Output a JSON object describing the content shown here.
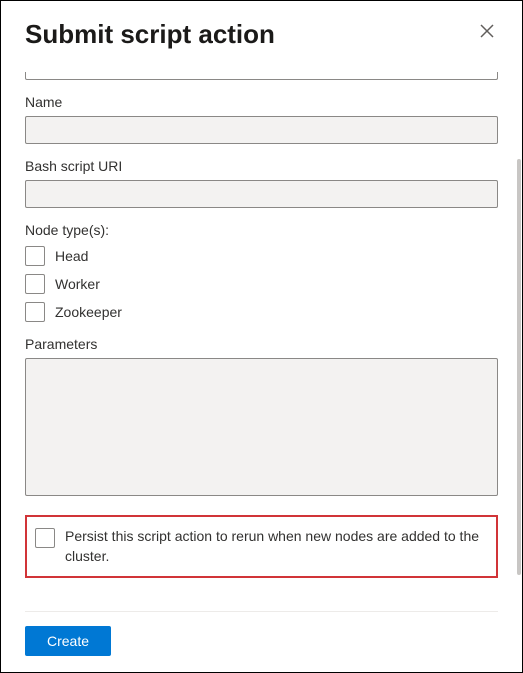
{
  "header": {
    "title": "Submit script action"
  },
  "fields": {
    "name_label": "Name",
    "name_value": "",
    "uri_label": "Bash script URI",
    "uri_value": "",
    "node_types_label": "Node type(s):",
    "node_types": {
      "head": "Head",
      "worker": "Worker",
      "zookeeper": "Zookeeper"
    },
    "parameters_label": "Parameters",
    "parameters_value": "",
    "persist_label": "Persist this script action to rerun when new nodes are added to the cluster."
  },
  "footer": {
    "create_label": "Create"
  }
}
